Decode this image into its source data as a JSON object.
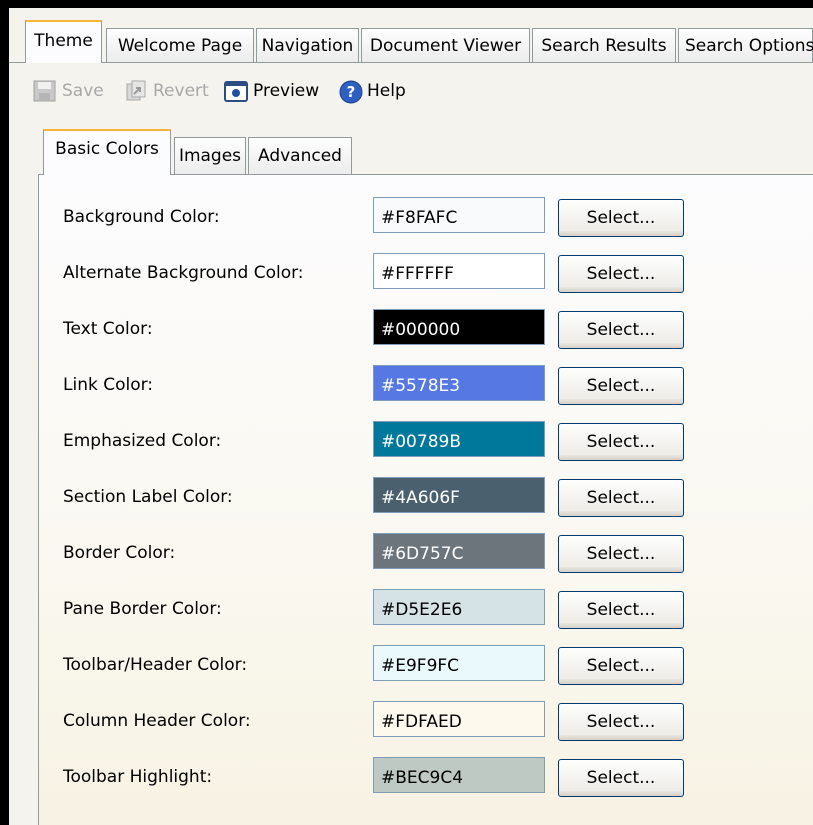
{
  "main_tabs": [
    {
      "label": "Theme",
      "active": true
    },
    {
      "label": "Welcome Page"
    },
    {
      "label": "Navigation"
    },
    {
      "label": "Document Viewer"
    },
    {
      "label": "Search Results"
    },
    {
      "label": "Search Options"
    }
  ],
  "toolbar": {
    "save_label": "Save",
    "revert_label": "Revert",
    "preview_label": "Preview",
    "help_label": "Help"
  },
  "inner_tabs": [
    {
      "label": "Basic Colors",
      "active": true
    },
    {
      "label": "Images"
    },
    {
      "label": "Advanced"
    }
  ],
  "colors": [
    {
      "label": "Background Color:",
      "value": "#F8FAFC",
      "bg": "#F8FAFC",
      "fg": "#000000"
    },
    {
      "label": "Alternate Background Color:",
      "value": "#FFFFFF",
      "bg": "#FFFFFF",
      "fg": "#000000"
    },
    {
      "label": "Text Color:",
      "value": "#000000",
      "bg": "#000000",
      "fg": "#FFFFFF"
    },
    {
      "label": "Link Color:",
      "value": "#5578E3",
      "bg": "#5578E3",
      "fg": "#FFFFFF"
    },
    {
      "label": "Emphasized Color:",
      "value": "#00789B",
      "bg": "#00789B",
      "fg": "#FFFFFF"
    },
    {
      "label": "Section Label Color:",
      "value": "#4A606F",
      "bg": "#4A606F",
      "fg": "#FFFFFF"
    },
    {
      "label": "Border Color:",
      "value": "#6D757C",
      "bg": "#6D757C",
      "fg": "#FFFFFF"
    },
    {
      "label": "Pane Border Color:",
      "value": "#D5E2E6",
      "bg": "#D5E2E6",
      "fg": "#000000"
    },
    {
      "label": "Toolbar/Header Color:",
      "value": "#E9F9FC",
      "bg": "#E9F9FC",
      "fg": "#000000"
    },
    {
      "label": "Column Header Color:",
      "value": "#FDFAED",
      "bg": "#FDFAED",
      "fg": "#000000"
    },
    {
      "label": "Toolbar Highlight:",
      "value": "#BEC9C4",
      "bg": "#BEC9C4",
      "fg": "#000000"
    }
  ],
  "select_label": "Select..."
}
